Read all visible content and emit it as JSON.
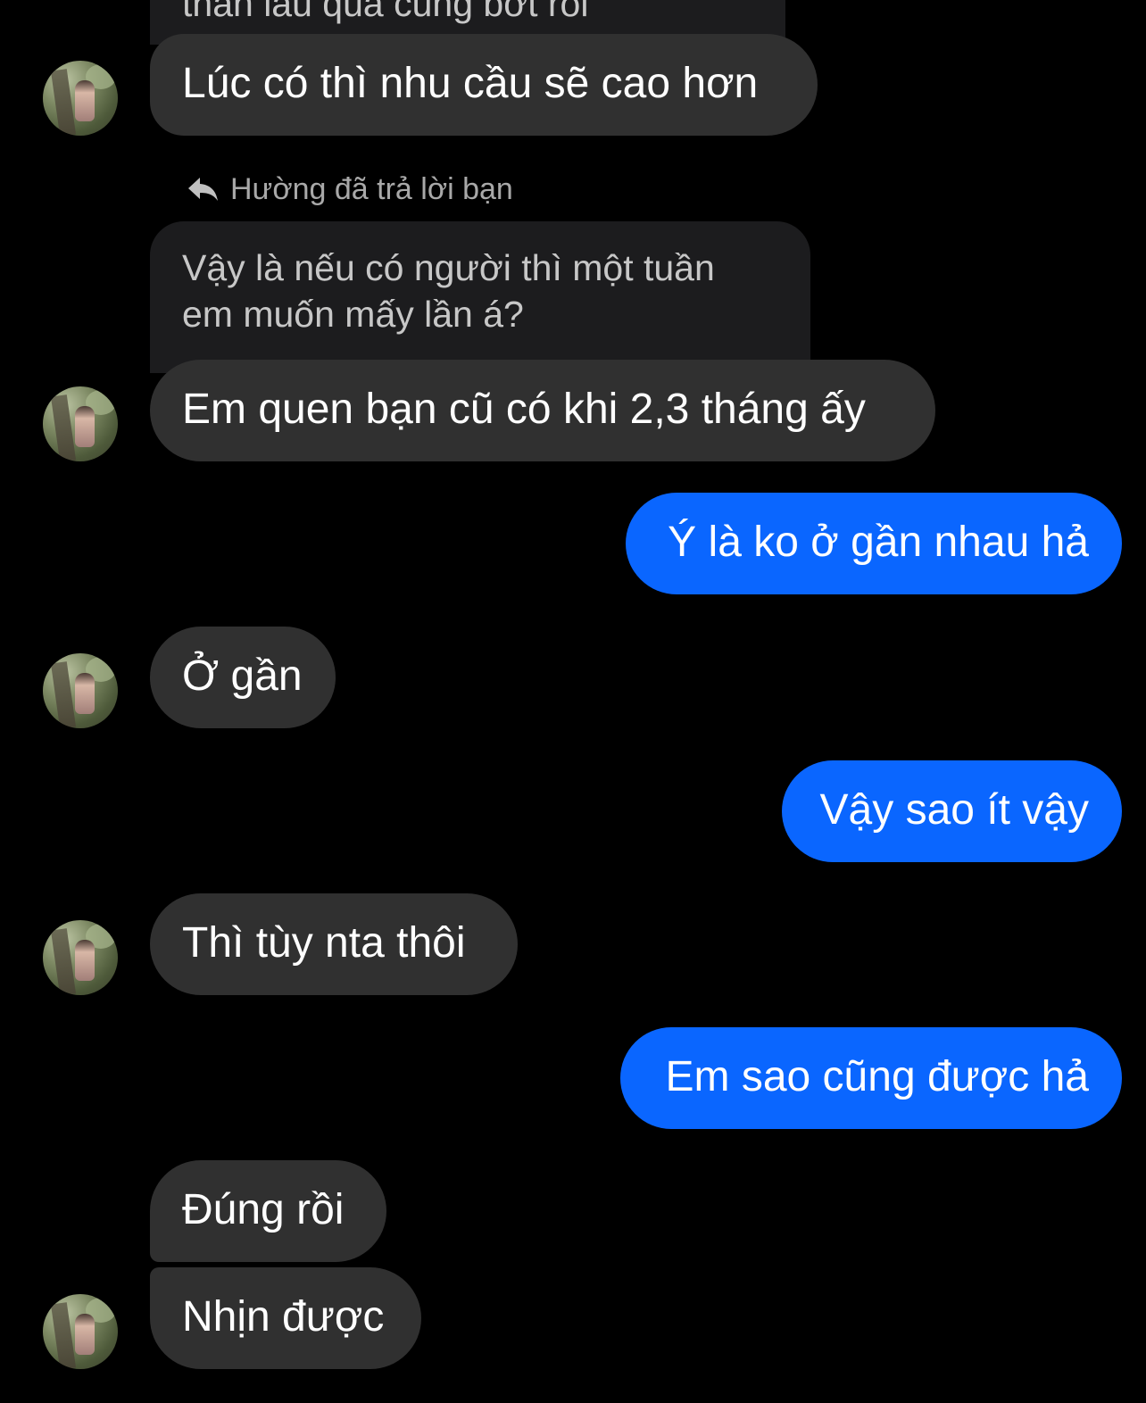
{
  "colors": {
    "background": "#000000",
    "incoming_bubble": "#303030",
    "outgoing_bubble": "#0a66ff",
    "quoted_bubble": "#1c1c1e",
    "reply_label": "#a8a8a8"
  },
  "top_fragment": {
    "text": "thân lâu quá cũng bớt rồi"
  },
  "messages": [
    {
      "direction": "incoming",
      "text": "Lúc có thì nhu cầu sẽ cao hơn",
      "avatar_icon": "contact-avatar"
    },
    {
      "direction": "incoming-reply",
      "reply_label": "Hường đã trả lời bạn",
      "reply_icon": "reply-arrow-icon",
      "quoted_lines": [
        "Vậy là nếu có người thì một tuần",
        "em muốn mấy lần á?"
      ],
      "text": "Em quen bạn cũ có khi 2,3 tháng ấy",
      "avatar_icon": "contact-avatar"
    },
    {
      "direction": "outgoing",
      "text": "Ý là ko ở gần nhau hả"
    },
    {
      "direction": "incoming",
      "text": "Ở gần",
      "avatar_icon": "contact-avatar"
    },
    {
      "direction": "outgoing",
      "text": "Vậy sao ít vậy"
    },
    {
      "direction": "incoming",
      "text": "Thì tùy nta thôi",
      "avatar_icon": "contact-avatar"
    },
    {
      "direction": "outgoing",
      "text": "Em sao cũng được hả"
    },
    {
      "direction": "incoming",
      "text": "Đúng rồi"
    },
    {
      "direction": "incoming",
      "text": "Nhịn được",
      "avatar_icon": "contact-avatar"
    }
  ]
}
